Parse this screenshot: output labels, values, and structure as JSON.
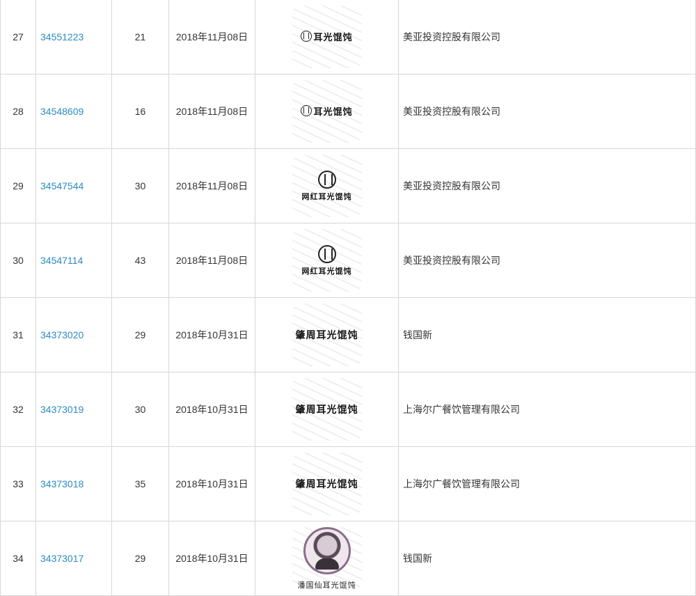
{
  "rows": [
    {
      "index": "27",
      "reg_no": "34551223",
      "class": "21",
      "date": "2018年11月08日",
      "logo_text": "耳光馄饨",
      "logo_type": "seal-inline",
      "owner": "美亚投资控股有限公司"
    },
    {
      "index": "28",
      "reg_no": "34548609",
      "class": "16",
      "date": "2018年11月08日",
      "logo_text": "耳光馄饨",
      "logo_type": "seal-inline",
      "owner": "美亚投资控股有限公司"
    },
    {
      "index": "29",
      "reg_no": "34547544",
      "class": "30",
      "date": "2018年11月08日",
      "logo_text": "网红耳光馄饨",
      "logo_type": "seal-stacked",
      "owner": "美亚投资控股有限公司"
    },
    {
      "index": "30",
      "reg_no": "34547114",
      "class": "43",
      "date": "2018年11月08日",
      "logo_text": "网红耳光馄饨",
      "logo_type": "seal-stacked",
      "owner": "美亚投资控股有限公司"
    },
    {
      "index": "31",
      "reg_no": "34373020",
      "class": "29",
      "date": "2018年10月31日",
      "logo_text": "肇周耳光馄饨",
      "logo_type": "text",
      "owner": "钱国新"
    },
    {
      "index": "32",
      "reg_no": "34373019",
      "class": "30",
      "date": "2018年10月31日",
      "logo_text": "肇周耳光馄饨",
      "logo_type": "text",
      "owner": "上海尔广餐饮管理有限公司"
    },
    {
      "index": "33",
      "reg_no": "34373018",
      "class": "35",
      "date": "2018年10月31日",
      "logo_text": "肇周耳光馄饨",
      "logo_type": "text",
      "owner": "上海尔广餐饮管理有限公司"
    },
    {
      "index": "34",
      "reg_no": "34373017",
      "class": "29",
      "date": "2018年10月31日",
      "logo_text": "潘国仙耳光馄饨",
      "logo_type": "portrait",
      "owner": "钱国新"
    }
  ],
  "colors": {
    "link": "#2a8bc1",
    "border": "#d6d6d6",
    "text": "#333333"
  }
}
